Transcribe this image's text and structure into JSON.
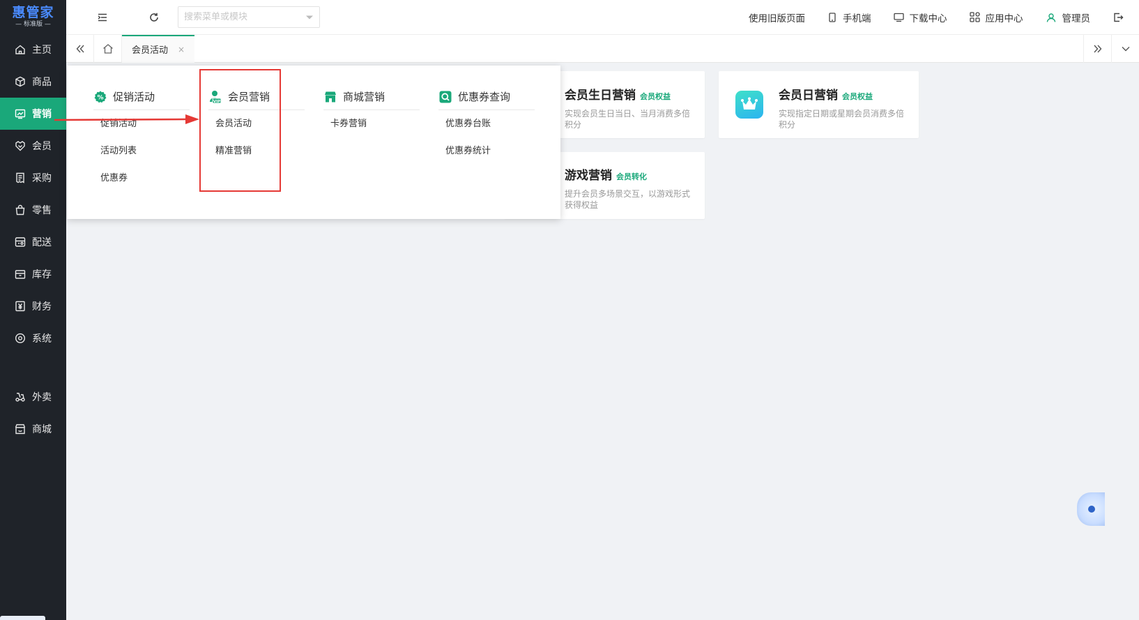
{
  "app": {
    "logo_main": "惠管家",
    "logo_sub": "— 标准版 —"
  },
  "sidebar": {
    "items": [
      {
        "label": "主页",
        "icon": "home-icon"
      },
      {
        "label": "商品",
        "icon": "box-icon"
      },
      {
        "label": "营销",
        "icon": "chart-icon",
        "active": true
      },
      {
        "label": "会员",
        "icon": "heart-shield-icon"
      },
      {
        "label": "采购",
        "icon": "receipt-icon"
      },
      {
        "label": "零售",
        "icon": "bag-icon"
      },
      {
        "label": "配送",
        "icon": "truck-icon"
      },
      {
        "label": "库存",
        "icon": "storage-icon"
      },
      {
        "label": "财务",
        "icon": "yen-icon"
      },
      {
        "label": "系统",
        "icon": "settings-icon"
      }
    ],
    "extra_items": [
      {
        "label": "外卖",
        "icon": "delivery-icon"
      },
      {
        "label": "商城",
        "icon": "store-icon"
      }
    ]
  },
  "header": {
    "search_placeholder": "搜索菜单或模块",
    "links": {
      "old_version": "使用旧版页面",
      "mobile": "手机端",
      "download": "下载中心",
      "apps": "应用中心",
      "user": "管理员"
    }
  },
  "tabs": {
    "active_tab": "会员活动",
    "close_glyph": "×"
  },
  "mega_menu": {
    "columns": [
      {
        "title": "促销活动",
        "icon": "percent-icon",
        "items": [
          "促销活动",
          "活动列表",
          "优惠券"
        ]
      },
      {
        "title": "会员营销",
        "icon": "vip-user-icon",
        "items": [
          "会员活动",
          "精准营销"
        ]
      },
      {
        "title": "商城营销",
        "icon": "shop-icon",
        "items": [
          "卡券营销"
        ]
      },
      {
        "title": "优惠券查询",
        "icon": "search-box-icon",
        "items": [
          "优惠券台账",
          "优惠券统计"
        ]
      }
    ]
  },
  "cards": [
    {
      "title": "会员生日营销",
      "badge": "会员权益",
      "desc": "实现会员生日当日、当月消费多倍积分"
    },
    {
      "title": "会员日营销",
      "badge": "会员权益",
      "desc": "实现指定日期或星期会员消费多倍积分",
      "icon": "crown-icon"
    },
    {
      "title": "游戏营销",
      "badge": "会员转化",
      "desc": "提升会员多场景交互，以游戏形式获得权益"
    }
  ],
  "colors": {
    "accent": "#1aa87a",
    "sidebar_bg": "#1f2329",
    "highlight_box": "#e53935",
    "logo": "#4a8bff"
  }
}
